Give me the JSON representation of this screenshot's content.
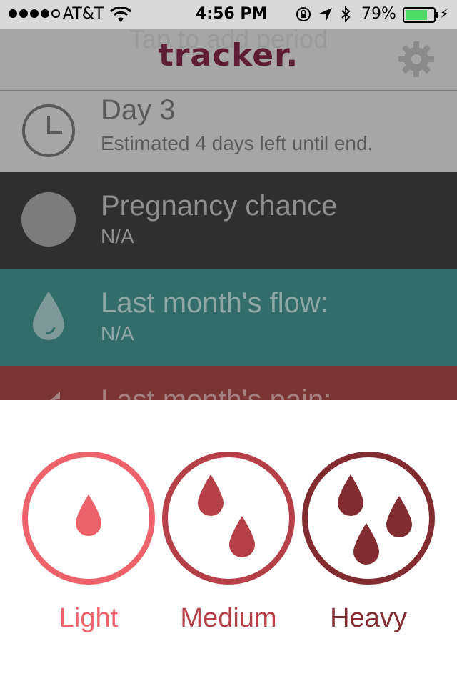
{
  "status_bar": {
    "carrier": "AT&T",
    "time": "4:56 PM",
    "battery_percent": "79%",
    "battery_level": 0.79,
    "signal_bars": 4,
    "icons": [
      "wifi-icon",
      "orientation-lock-icon",
      "location-arrow-icon",
      "bluetooth-icon",
      "charging-bolt-icon"
    ]
  },
  "header": {
    "hint": "Tap to add period",
    "brand": "tracker.",
    "settings_icon": "gear-icon"
  },
  "rows": {
    "day": {
      "title": "Day 3",
      "subtitle": "Estimated 4 days left until end.",
      "icon": "clock-icon"
    },
    "pregnancy": {
      "title": "Pregnancy chance",
      "subtitle": "N/A",
      "icon": "circle-icon"
    },
    "flow": {
      "title": "Last month's flow:",
      "subtitle": "N/A",
      "icon": "drop-icon"
    },
    "pain": {
      "title": "Last month's pain:",
      "icon": "pain-icon"
    }
  },
  "flow_picker": {
    "options": [
      {
        "label": "Light",
        "color": "#ee636b",
        "drops": 1
      },
      {
        "label": "Medium",
        "color": "#b54047",
        "drops": 2
      },
      {
        "label": "Heavy",
        "color": "#822b31",
        "drops": 3
      }
    ]
  },
  "colors": {
    "brand": "#5f1d35",
    "row_day": "#a6a6a6",
    "row_pregnancy": "#2f2f2f",
    "row_flow": "#326d6b",
    "row_pain": "#7a3434"
  }
}
